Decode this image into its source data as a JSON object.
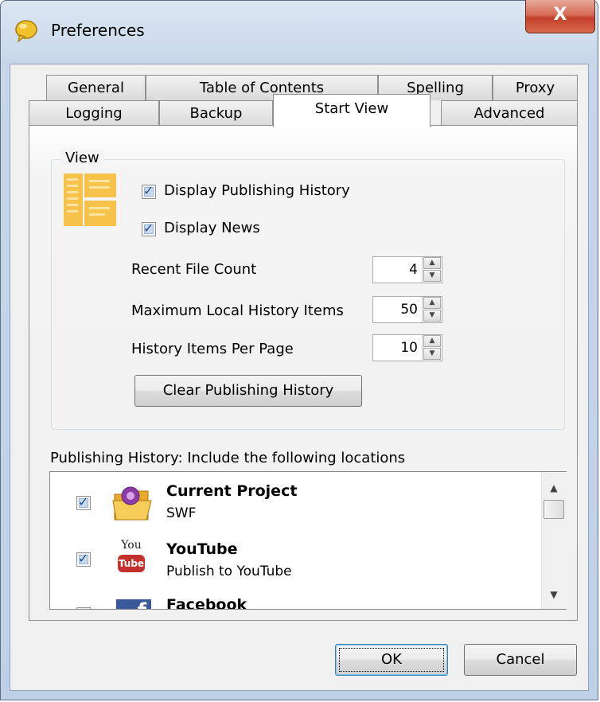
{
  "window": {
    "title": "Preferences",
    "close_glyph": "X",
    "app_icon": "app-bubble-icon"
  },
  "tabs_row1": [
    {
      "label": "General"
    },
    {
      "label": "Table of Contents"
    },
    {
      "label": "Spelling"
    },
    {
      "label": "Proxy"
    }
  ],
  "tabs_row2": [
    {
      "label": "Logging"
    },
    {
      "label": "Backup"
    },
    {
      "label": "Start View",
      "active": true
    },
    {
      "label": "Advanced"
    }
  ],
  "view_group": {
    "label": "View",
    "display_publishing_history": {
      "label": "Display Publishing History",
      "checked": true
    },
    "display_news": {
      "label": "Display News",
      "checked": true
    },
    "recent_file_count": {
      "label": "Recent File Count",
      "value": "4"
    },
    "max_local_history": {
      "label": "Maximum Local History Items",
      "value": "50"
    },
    "history_per_page": {
      "label": "History Items Per Page",
      "value": "10"
    },
    "clear_button": "Clear Publishing History"
  },
  "publishing_history": {
    "label": "Publishing History: Include the following locations",
    "items": [
      {
        "title": "Current Project",
        "subtitle": "SWF",
        "checked": true,
        "icon": "folder-icon"
      },
      {
        "title": "YouTube",
        "subtitle": "Publish to YouTube",
        "checked": true,
        "icon": "youtube-icon",
        "icon_text_top": "You",
        "icon_text_bottom": "Tube"
      },
      {
        "title": "Facebook",
        "subtitle": "",
        "checked": true,
        "icon": "facebook-icon",
        "icon_text": "f"
      }
    ]
  },
  "footer": {
    "ok": "OK",
    "cancel": "Cancel"
  },
  "colors": {
    "close_red": "#c3402a",
    "check_blue": "#1f4f8a",
    "youtube_red": "#c4302b",
    "facebook_blue": "#3b5998",
    "folder_yellow": "#f3c64a"
  }
}
